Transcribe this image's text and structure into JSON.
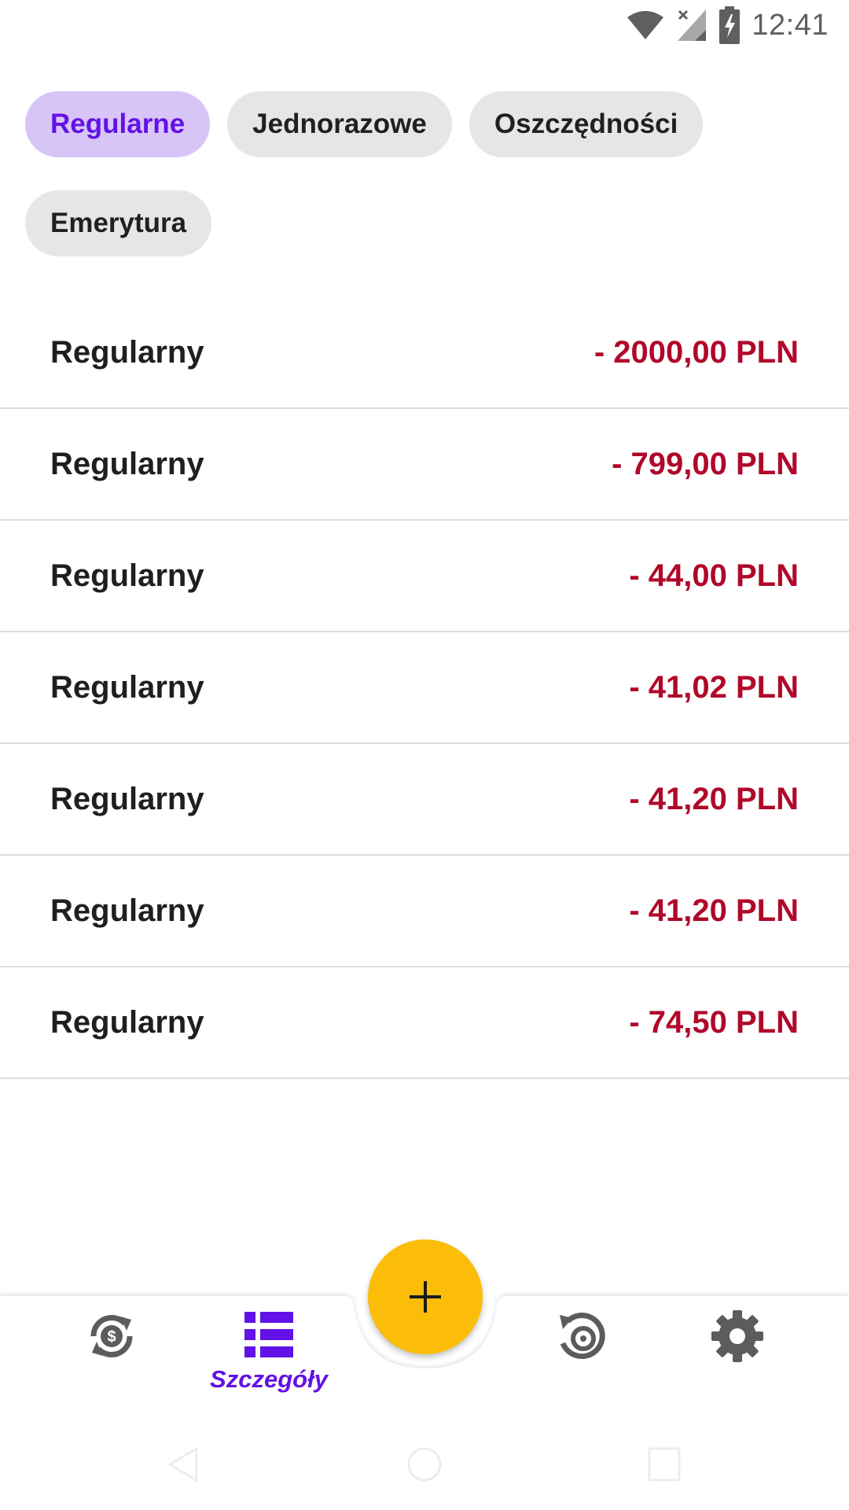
{
  "status_bar": {
    "time": "12:41",
    "icons": [
      "wifi-icon",
      "signal-no-service-icon",
      "battery-charging-icon"
    ]
  },
  "filters": {
    "chips": [
      {
        "label": "Regularne",
        "selected": true
      },
      {
        "label": "Jednorazowe",
        "selected": false
      },
      {
        "label": "Oszczędności",
        "selected": false
      },
      {
        "label": "Emerytura",
        "selected": false
      }
    ]
  },
  "transactions": [
    {
      "label": "Regularny",
      "amount": "- 2000,00 PLN"
    },
    {
      "label": "Regularny",
      "amount": "- 799,00 PLN"
    },
    {
      "label": "Regularny",
      "amount": "- 44,00 PLN"
    },
    {
      "label": "Regularny",
      "amount": "- 41,02 PLN"
    },
    {
      "label": "Regularny",
      "amount": "- 41,20 PLN"
    },
    {
      "label": "Regularny",
      "amount": "- 41,20 PLN"
    },
    {
      "label": "Regularny",
      "amount": "- 74,50 PLN"
    }
  ],
  "bottom_nav": {
    "items": [
      {
        "icon": "currency-exchange-icon",
        "label": ""
      },
      {
        "icon": "list-icon",
        "label": "Szczegóły",
        "active": true
      },
      {
        "icon": "history-icon",
        "label": ""
      },
      {
        "icon": "gear-icon",
        "label": ""
      }
    ],
    "fab_icon": "plus-icon"
  },
  "colors": {
    "accent": "#6211e6",
    "chip_selected_bg": "#d8c5f8",
    "chip_bg": "#e6e6e6",
    "amount_negative": "#b0082a",
    "fab": "#fbbd08",
    "icon_inactive": "#5c5c5c"
  }
}
